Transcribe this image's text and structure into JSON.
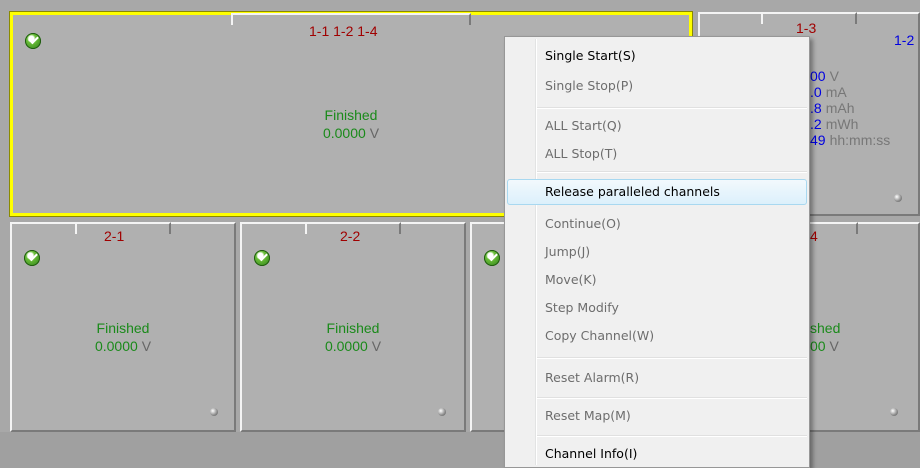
{
  "colors": {
    "yellow_select": "#ffff00",
    "label_red": "#a00000",
    "status_green": "#1a8a1a",
    "stat_blue": "#0000e0"
  },
  "panels": {
    "big": {
      "label": "1-1 1-2 1-4",
      "status": "Finished",
      "voltage_value": "0.0000",
      "voltage_unit": "V"
    },
    "p13": {
      "label": "1-3",
      "right_label": "1-2",
      "stats": [
        {
          "value": "00",
          "unit": "V"
        },
        {
          "value": ".0",
          "unit": "mA"
        },
        {
          "value": ".8",
          "unit": "mAh"
        },
        {
          "value": ".2",
          "unit": "mWh"
        },
        {
          "value": "49",
          "unit": "hh:mm:ss"
        }
      ]
    },
    "p21": {
      "label": "2-1",
      "status": "Finished",
      "voltage_value": "0.0000",
      "voltage_unit": "V"
    },
    "p22": {
      "label": "2-2",
      "status": "Finished",
      "voltage_value": "0.0000",
      "voltage_unit": "V"
    },
    "p24": {
      "label": "4",
      "status": "shed",
      "voltage_value": "00",
      "voltage_unit": "V"
    }
  },
  "menu": {
    "items": [
      {
        "label": "Single Start(S)"
      },
      {
        "label": "Single Stop(P)"
      },
      {
        "label": "ALL Start(Q)"
      },
      {
        "label": "ALL Stop(T)"
      },
      {
        "label": "Release paralleled channels"
      },
      {
        "label": "Continue(O)"
      },
      {
        "label": "Jump(J)"
      },
      {
        "label": "Move(K)"
      },
      {
        "label": "Step Modify"
      },
      {
        "label": "Copy Channel(W)"
      },
      {
        "label": "Reset Alarm(R)"
      },
      {
        "label": "Reset Map(M)"
      },
      {
        "label": "Channel Info(I)"
      }
    ]
  }
}
